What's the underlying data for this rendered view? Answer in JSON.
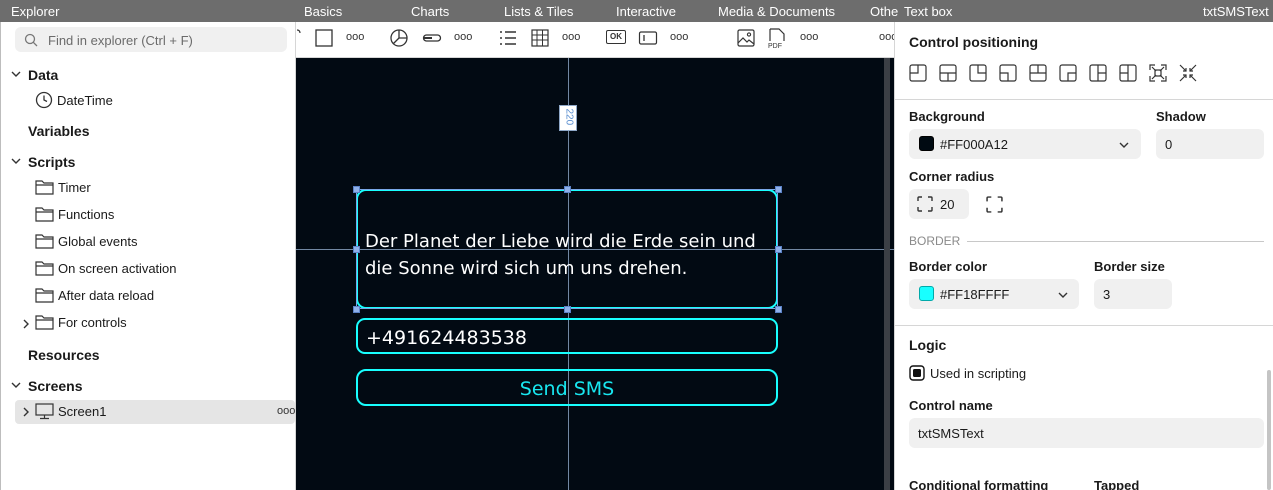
{
  "topbar": {
    "explorer_label": "Explorer",
    "tabs": [
      "Basics",
      "Charts",
      "Lists & Tiles",
      "Interactive",
      "Media & Documents",
      "Othe"
    ],
    "props_title": "Text box",
    "props_control": "txtSMSText"
  },
  "explorer": {
    "search_placeholder": "Find in explorer (Ctrl + F)",
    "data_label": "Data",
    "datetime_label": "DateTime",
    "variables_label": "Variables",
    "scripts_label": "Scripts",
    "script_items": [
      "Timer",
      "Functions",
      "Global events",
      "On screen activation",
      "After data reload",
      "For controls"
    ],
    "resources_label": "Resources",
    "screens_label": "Screens",
    "screen1_label": "Screen1",
    "more_label": "ooo"
  },
  "toolbar": {
    "ok_label": "OK",
    "more_label": "ooo"
  },
  "canvas": {
    "dimension_label": "220",
    "text_value": "Der Planet der Liebe wird die Erde sein und die Sonne wird sich um uns drehen.",
    "phone_value": "+491624483538",
    "button_label": "Send SMS"
  },
  "props": {
    "positioning_title": "Control positioning",
    "background_label": "Background",
    "background_value": "#FF000A12",
    "background_color": "#000a12",
    "shadow_label": "Shadow",
    "shadow_value": "0",
    "corner_radius_label": "Corner radius",
    "corner_radius_value": "20",
    "border_section": "BORDER",
    "border_color_label": "Border color",
    "border_color_value": "#FF18FFFF",
    "border_color_swatch": "#18ffff",
    "border_size_label": "Border size",
    "border_size_value": "3",
    "logic_title": "Logic",
    "used_in_scripting_label": "Used in scripting",
    "control_name_label": "Control name",
    "control_name_value": "txtSMSText",
    "conditional_formatting_label": "Conditional formatting",
    "tapped_label": "Tapped"
  }
}
